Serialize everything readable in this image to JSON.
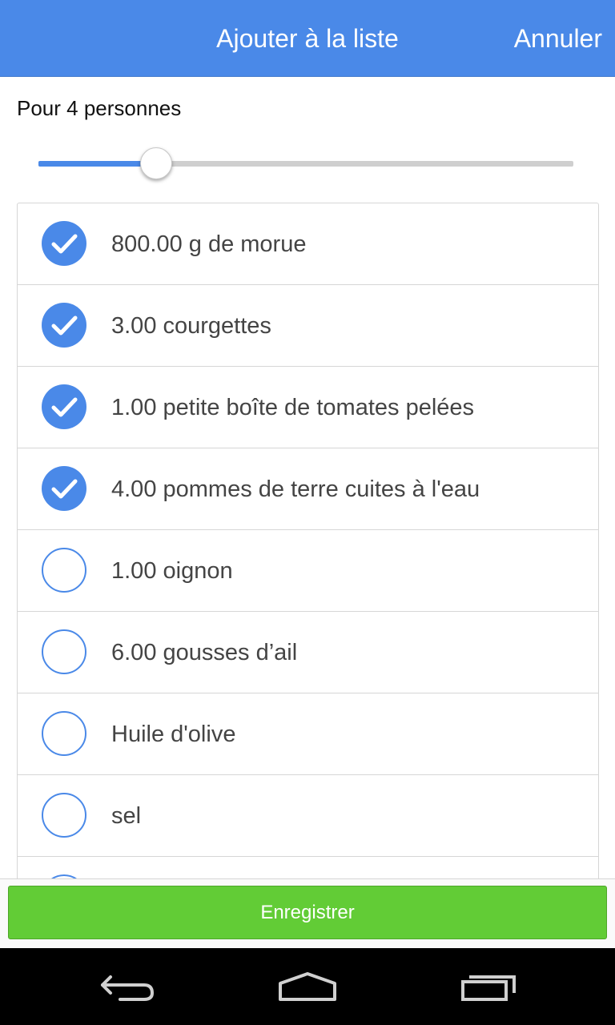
{
  "header": {
    "title": "Ajouter à la liste",
    "cancel_label": "Annuler",
    "color": "#4a89e8"
  },
  "servings": {
    "label": "Pour 4 personnes",
    "slider_fraction": 0.22
  },
  "ingredients": [
    {
      "label": "800.00 g de morue",
      "checked": true
    },
    {
      "label": "3.00 courgettes",
      "checked": true
    },
    {
      "label": "1.00 petite boîte de tomates pelées",
      "checked": true
    },
    {
      "label": "4.00 pommes de terre cuites à l'eau",
      "checked": true
    },
    {
      "label": "1.00 oignon",
      "checked": false
    },
    {
      "label": "6.00 gousses d’ail",
      "checked": false
    },
    {
      "label": "Huile d'olive",
      "checked": false
    },
    {
      "label": "sel",
      "checked": false
    },
    {
      "label": "",
      "checked": false
    }
  ],
  "footer": {
    "save_label": "Enregistrer",
    "save_color": "#62cc36"
  },
  "system_nav": {
    "icons": [
      "back-icon",
      "home-icon",
      "recent-apps-icon"
    ]
  }
}
